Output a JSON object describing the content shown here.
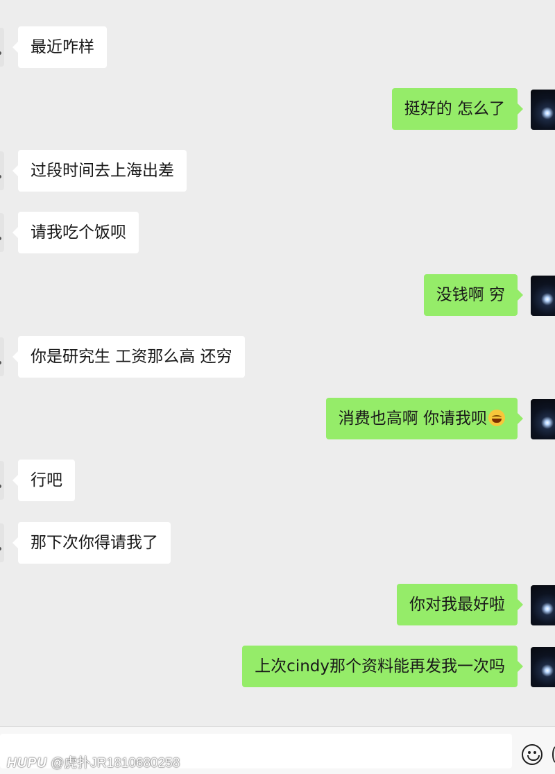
{
  "messages": [
    {
      "side": "left",
      "text": "最近咋样"
    },
    {
      "side": "right",
      "text": "挺好的 怎么了"
    },
    {
      "side": "left",
      "text": "过段时间去上海出差"
    },
    {
      "side": "left",
      "text": "请我吃个饭呗"
    },
    {
      "side": "right",
      "text": "没钱啊 穷"
    },
    {
      "side": "left",
      "text": "你是研究生 工资那么高 还穷"
    },
    {
      "side": "right",
      "text": "消费也高啊 你请我呗",
      "emoji": "tears-of-joy-emoji-icon"
    },
    {
      "side": "left",
      "text": "行吧"
    },
    {
      "side": "left",
      "text": "那下次你得请我了"
    },
    {
      "side": "right",
      "text": "你对我最好啦"
    },
    {
      "side": "right",
      "text": "上次cindy那个资料能再发我一次吗"
    }
  ],
  "input_bar": {
    "emoji_button_icon": "smiley-icon",
    "more_button_icon": "plus-icon"
  },
  "watermark": {
    "logo": "HUPU",
    "text": "@虎扑JR1810680258"
  },
  "colors": {
    "background": "#ededed",
    "sent_bubble": "#95ec69",
    "received_bubble": "#ffffff"
  }
}
